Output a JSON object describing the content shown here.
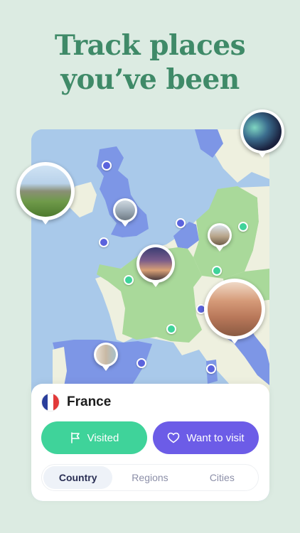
{
  "headline": {
    "line1": "Track places",
    "line2": "you’ve been"
  },
  "colors": {
    "background": "#dcebe2",
    "headline": "#3f8a68",
    "sea": "#a9c9ea",
    "visited_country": "#a9d99a",
    "highlight_country": "#7d96e6",
    "other_land": "#eef0df",
    "visited_pin": "#3fd39a",
    "want_pin": "#5b63dd",
    "visited_button": "#3fd39a",
    "want_button": "#6c5ce7"
  },
  "selected_country": {
    "flag_icon": "france-flag-icon",
    "name": "France"
  },
  "actions": {
    "visited_label": "Visited",
    "visited_icon": "flag-icon",
    "want_label": "Want to visit",
    "want_icon": "heart-icon"
  },
  "tabs": [
    {
      "label": "Country",
      "active": true
    },
    {
      "label": "Regions",
      "active": false
    },
    {
      "label": "Cities",
      "active": false
    }
  ],
  "photo_markers": [
    {
      "name": "ireland-castle-photo",
      "subject": "castle"
    },
    {
      "name": "aurora-photo",
      "subject": "aurora"
    },
    {
      "name": "london-photo",
      "subject": "london"
    },
    {
      "name": "berlin-photo",
      "subject": "cathedral"
    },
    {
      "name": "paris-photo",
      "subject": "eiffel-tower"
    },
    {
      "name": "rome-photo",
      "subject": "colosseum"
    },
    {
      "name": "spain-photo",
      "subject": "street"
    }
  ]
}
